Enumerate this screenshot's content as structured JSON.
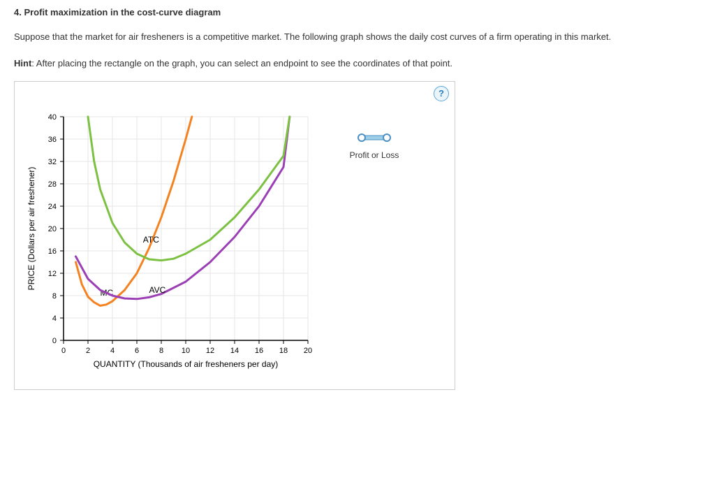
{
  "question": {
    "number_title": "4. Profit maximization in the cost-curve diagram",
    "body": "Suppose that the market for air fresheners is a competitive market. The following graph shows the daily cost curves of a firm operating in this market.",
    "hint_label": "Hint",
    "hint_text": ": After placing the rectangle on the graph, you can select an endpoint to see the coordinates of that point."
  },
  "help_icon": "?",
  "legend": {
    "tool_label": "Profit or Loss"
  },
  "chart_data": {
    "type": "line",
    "xlabel": "QUANTITY (Thousands of air fresheners per day)",
    "ylabel": "PRICE (Dollars per air freshener)",
    "xlim": [
      0,
      20
    ],
    "ylim": [
      0,
      40
    ],
    "xticks": [
      0,
      2,
      4,
      6,
      8,
      10,
      12,
      14,
      16,
      18,
      20
    ],
    "yticks": [
      0,
      4,
      8,
      12,
      16,
      20,
      24,
      28,
      32,
      36,
      40
    ],
    "series": [
      {
        "name": "MC",
        "color": "#f58220",
        "label_xy": [
          3,
          8
        ],
        "x": [
          1,
          1.5,
          2,
          2.5,
          3,
          3.5,
          4,
          5,
          6,
          7,
          8,
          9,
          10,
          10.5
        ],
        "y": [
          14,
          10,
          7.8,
          6.8,
          6.2,
          6.4,
          7,
          9,
          12,
          16.5,
          22,
          28.5,
          36,
          40
        ]
      },
      {
        "name": "AVC",
        "color": "#9b3fb5",
        "label_xy": [
          7,
          8.5
        ],
        "x": [
          1,
          2,
          3,
          4,
          5,
          6,
          7,
          8,
          10,
          12,
          14,
          16,
          18,
          18.5
        ],
        "y": [
          15,
          11,
          9,
          8,
          7.5,
          7.4,
          7.7,
          8.3,
          10.5,
          14,
          18.5,
          24,
          31,
          40
        ]
      },
      {
        "name": "ATC",
        "color": "#7cc142",
        "label_xy": [
          6.5,
          17.5
        ],
        "x": [
          2,
          2.5,
          3,
          4,
          5,
          6,
          7,
          8,
          9,
          10,
          12,
          14,
          16,
          18,
          18.5
        ],
        "y": [
          40,
          32,
          27,
          21,
          17.5,
          15.5,
          14.5,
          14.3,
          14.6,
          15.5,
          18,
          22,
          27,
          33,
          40
        ]
      }
    ]
  }
}
